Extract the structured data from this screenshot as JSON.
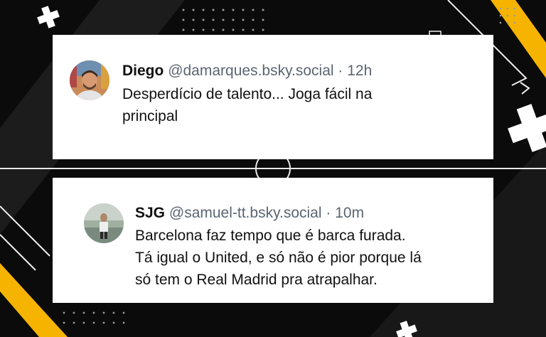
{
  "colors": {
    "background": "#0b0b0b",
    "accent": "#f6b400",
    "card": "#ffffff",
    "muted": "#5b6571"
  },
  "posts": [
    {
      "author": "Diego",
      "handle": "@damarques.bsky.social",
      "separator": "·",
      "time": "12h",
      "lines": [
        "Desperdício de talento... Joga fácil na",
        "principal"
      ],
      "avatar_icon": "profile-photo"
    },
    {
      "author": "SJG",
      "handle": "@samuel-tt.bsky.social",
      "separator": "·",
      "time": "10m",
      "lines": [
        "Barcelona faz tempo que é barca furada.",
        "Tá igual o United, e só não é pior porque lá",
        "só tem o Real Madrid pra atrapalhar."
      ],
      "avatar_icon": "profile-photo"
    }
  ]
}
